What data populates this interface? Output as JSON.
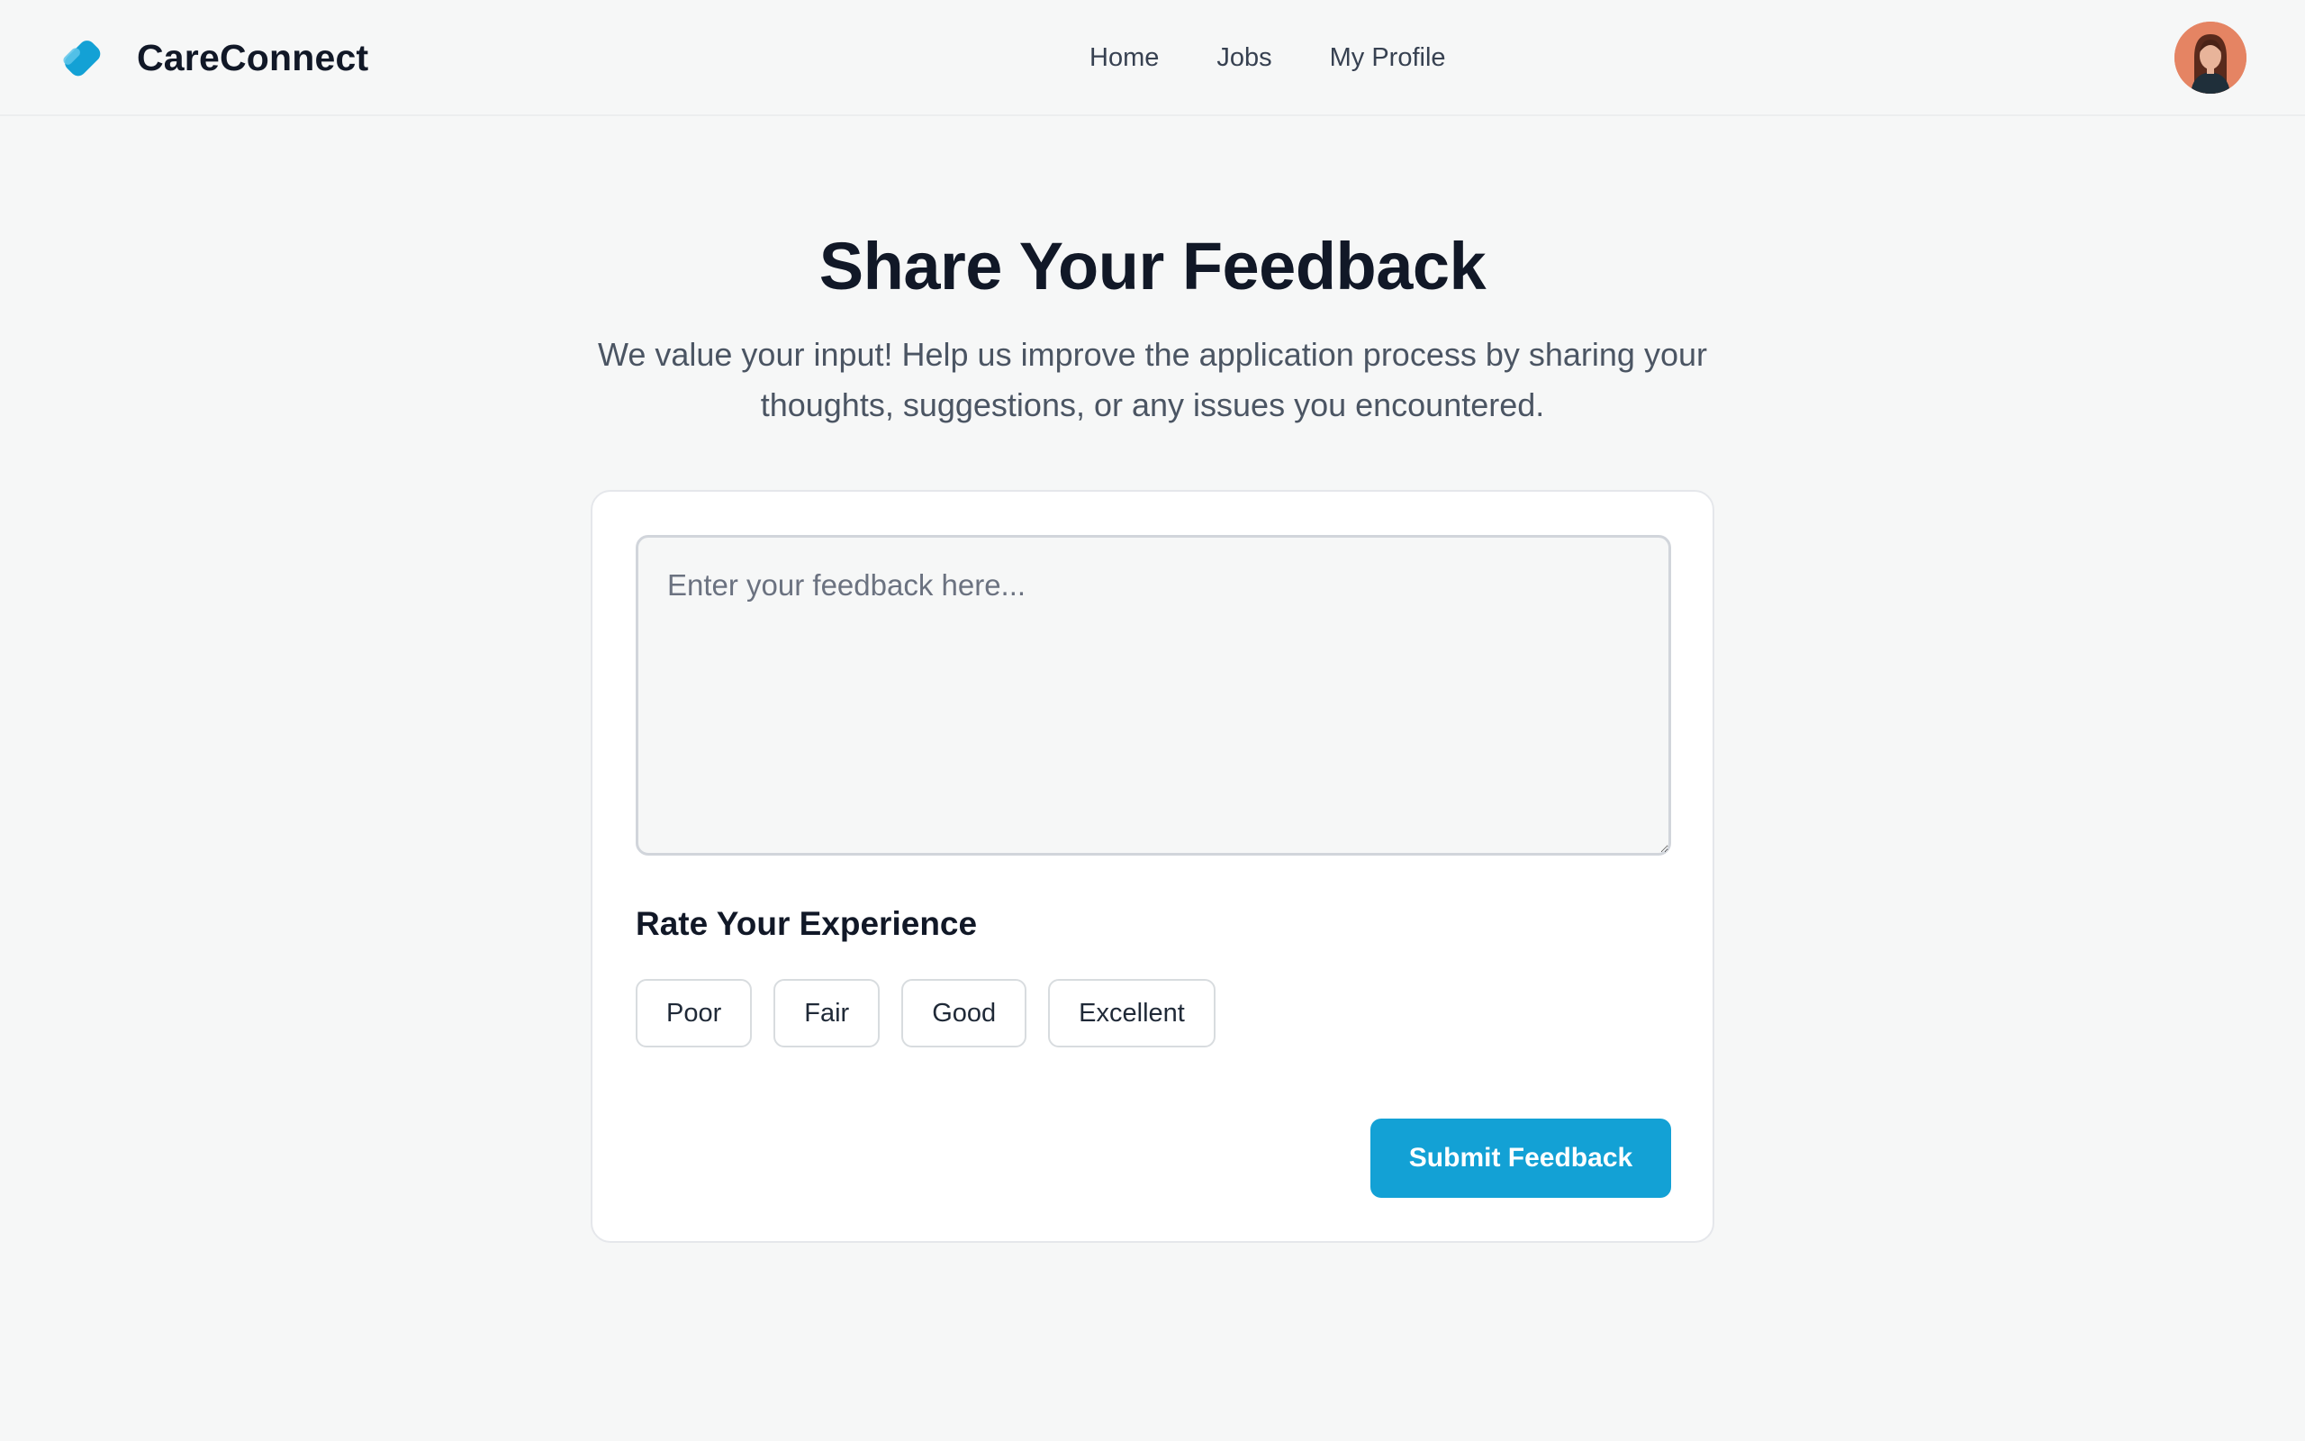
{
  "header": {
    "brand_name": "CareConnect",
    "logo_icon": "tag-icon",
    "nav": [
      {
        "label": "Home"
      },
      {
        "label": "Jobs"
      },
      {
        "label": "My Profile"
      }
    ],
    "avatar_icon": "user-avatar"
  },
  "main": {
    "title": "Share Your Feedback",
    "subtitle": "We value your input! Help us improve the application process by sharing your thoughts, suggestions, or any issues you encountered."
  },
  "form": {
    "feedback_value": "",
    "feedback_placeholder": "Enter your feedback here...",
    "rate_label": "Rate Your Experience",
    "ratings": [
      {
        "label": "Poor"
      },
      {
        "label": "Fair"
      },
      {
        "label": "Good"
      },
      {
        "label": "Excellent"
      }
    ],
    "submit_label": "Submit Feedback"
  },
  "colors": {
    "accent": "#13a1d5",
    "background": "#f6f7f7",
    "card": "#ffffff",
    "text_primary": "#111827",
    "text_secondary": "#4b5563"
  }
}
